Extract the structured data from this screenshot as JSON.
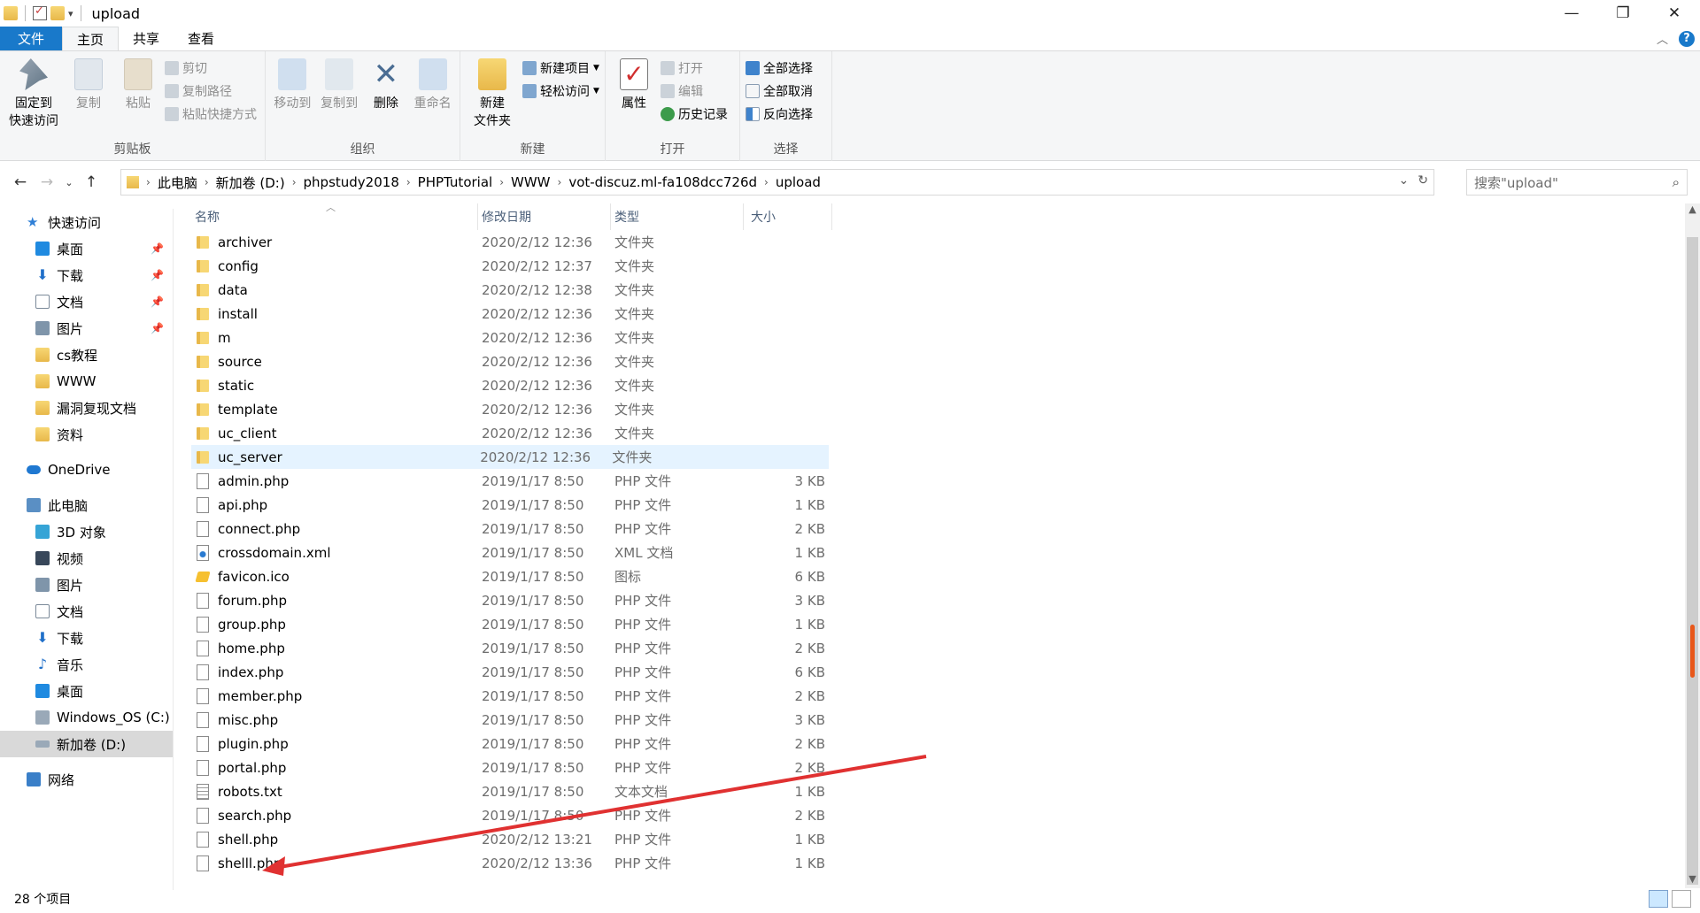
{
  "window": {
    "title": "upload",
    "controls": {
      "minimize": "—",
      "maximize": "❐",
      "close": "✕"
    }
  },
  "tabs": [
    {
      "label": "文件"
    },
    {
      "label": "主页"
    },
    {
      "label": "共享"
    },
    {
      "label": "查看"
    }
  ],
  "ribbon": {
    "clipboard": {
      "label": "剪贴板",
      "pin": "固定到\n快速访问",
      "copy": "复制",
      "paste": "粘贴",
      "cut": "剪切",
      "copy_path": "复制路径",
      "paste_shortcut": "粘贴快捷方式"
    },
    "organize": {
      "label": "组织",
      "move_to": "移动到",
      "copy_to": "复制到",
      "delete": "删除",
      "rename": "重命名"
    },
    "new": {
      "label": "新建",
      "new_folder": "新建\n文件夹",
      "new_item": "新建项目",
      "easy_access": "轻松访问"
    },
    "open": {
      "label": "打开",
      "properties": "属性",
      "open": "打开",
      "edit": "编辑",
      "history": "历史记录"
    },
    "select": {
      "label": "选择",
      "select_all": "全部选择",
      "select_none": "全部取消",
      "invert": "反向选择"
    }
  },
  "address": {
    "crumbs": [
      "此电脑",
      "新加卷 (D:)",
      "phpstudy2018",
      "PHPTutorial",
      "WWW",
      "vot-discuz.ml-fa108dcc726d",
      "upload"
    ],
    "search_placeholder": "搜索\"upload\""
  },
  "nav": {
    "quick_access": "快速访问",
    "quick_items": [
      {
        "label": "桌面",
        "pinned": true
      },
      {
        "label": "下载",
        "pinned": true
      },
      {
        "label": "文档",
        "pinned": true
      },
      {
        "label": "图片",
        "pinned": true
      },
      {
        "label": "cs教程",
        "pinned": false
      },
      {
        "label": "WWW",
        "pinned": false
      },
      {
        "label": "漏洞复现文档",
        "pinned": false
      },
      {
        "label": "资料",
        "pinned": false
      }
    ],
    "onedrive": "OneDrive",
    "this_pc": "此电脑",
    "pc_items": [
      "3D 对象",
      "视频",
      "图片",
      "文档",
      "下载",
      "音乐",
      "桌面",
      "Windows_OS (C:)",
      "新加卷 (D:)"
    ],
    "network": "网络"
  },
  "columns": {
    "name": "名称",
    "date": "修改日期",
    "type": "类型",
    "size": "大小"
  },
  "files": [
    {
      "name": "archiver",
      "date": "2020/2/12 12:36",
      "type": "文件夹",
      "size": "",
      "icon": "folder"
    },
    {
      "name": "config",
      "date": "2020/2/12 12:37",
      "type": "文件夹",
      "size": "",
      "icon": "folder"
    },
    {
      "name": "data",
      "date": "2020/2/12 12:38",
      "type": "文件夹",
      "size": "",
      "icon": "folder"
    },
    {
      "name": "install",
      "date": "2020/2/12 12:36",
      "type": "文件夹",
      "size": "",
      "icon": "folder"
    },
    {
      "name": "m",
      "date": "2020/2/12 12:36",
      "type": "文件夹",
      "size": "",
      "icon": "folder"
    },
    {
      "name": "source",
      "date": "2020/2/12 12:36",
      "type": "文件夹",
      "size": "",
      "icon": "folder"
    },
    {
      "name": "static",
      "date": "2020/2/12 12:36",
      "type": "文件夹",
      "size": "",
      "icon": "folder"
    },
    {
      "name": "template",
      "date": "2020/2/12 12:36",
      "type": "文件夹",
      "size": "",
      "icon": "folder"
    },
    {
      "name": "uc_client",
      "date": "2020/2/12 12:36",
      "type": "文件夹",
      "size": "",
      "icon": "folder"
    },
    {
      "name": "uc_server",
      "date": "2020/2/12 12:36",
      "type": "文件夹",
      "size": "",
      "icon": "folder",
      "selected": true
    },
    {
      "name": "admin.php",
      "date": "2019/1/17 8:50",
      "type": "PHP 文件",
      "size": "3 KB",
      "icon": "file"
    },
    {
      "name": "api.php",
      "date": "2019/1/17 8:50",
      "type": "PHP 文件",
      "size": "1 KB",
      "icon": "file"
    },
    {
      "name": "connect.php",
      "date": "2019/1/17 8:50",
      "type": "PHP 文件",
      "size": "2 KB",
      "icon": "file"
    },
    {
      "name": "crossdomain.xml",
      "date": "2019/1/17 8:50",
      "type": "XML 文档",
      "size": "1 KB",
      "icon": "xml"
    },
    {
      "name": "favicon.ico",
      "date": "2019/1/17 8:50",
      "type": "图标",
      "size": "6 KB",
      "icon": "ico"
    },
    {
      "name": "forum.php",
      "date": "2019/1/17 8:50",
      "type": "PHP 文件",
      "size": "3 KB",
      "icon": "file"
    },
    {
      "name": "group.php",
      "date": "2019/1/17 8:50",
      "type": "PHP 文件",
      "size": "1 KB",
      "icon": "file"
    },
    {
      "name": "home.php",
      "date": "2019/1/17 8:50",
      "type": "PHP 文件",
      "size": "2 KB",
      "icon": "file"
    },
    {
      "name": "index.php",
      "date": "2019/1/17 8:50",
      "type": "PHP 文件",
      "size": "6 KB",
      "icon": "file"
    },
    {
      "name": "member.php",
      "date": "2019/1/17 8:50",
      "type": "PHP 文件",
      "size": "2 KB",
      "icon": "file"
    },
    {
      "name": "misc.php",
      "date": "2019/1/17 8:50",
      "type": "PHP 文件",
      "size": "3 KB",
      "icon": "file"
    },
    {
      "name": "plugin.php",
      "date": "2019/1/17 8:50",
      "type": "PHP 文件",
      "size": "2 KB",
      "icon": "file"
    },
    {
      "name": "portal.php",
      "date": "2019/1/17 8:50",
      "type": "PHP 文件",
      "size": "2 KB",
      "icon": "file"
    },
    {
      "name": "robots.txt",
      "date": "2019/1/17 8:50",
      "type": "文本文档",
      "size": "1 KB",
      "icon": "txt"
    },
    {
      "name": "search.php",
      "date": "2019/1/17 8:50",
      "type": "PHP 文件",
      "size": "2 KB",
      "icon": "file"
    },
    {
      "name": "shell.php",
      "date": "2020/2/12 13:21",
      "type": "PHP 文件",
      "size": "1 KB",
      "icon": "file"
    },
    {
      "name": "shelll.php",
      "date": "2020/2/12 13:36",
      "type": "PHP 文件",
      "size": "1 KB",
      "icon": "file"
    }
  ],
  "status": {
    "count": "28 个项目"
  },
  "colors": {
    "accent": "#1979ca",
    "selection": "#e5f3ff",
    "annotation": "#e03131"
  }
}
